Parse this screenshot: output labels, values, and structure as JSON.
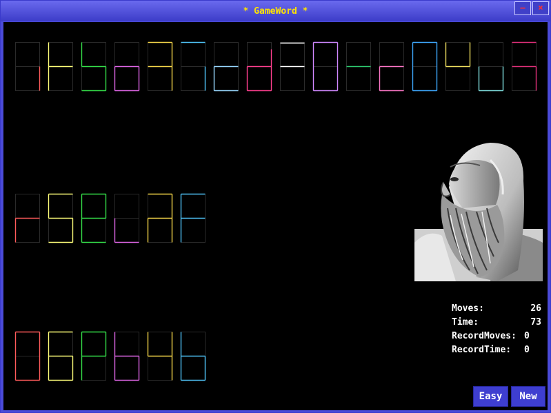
{
  "window": {
    "title": "* GameWord *",
    "minimize_glyph": "–",
    "close_glyph": "×"
  },
  "colors": {
    "background": "#000000",
    "title_text": "#ffe400",
    "titlebar": "#4a4ad8",
    "button": "#3e3ed0",
    "dim_segment": "#2a2a2a"
  },
  "palette": [
    "#ff5b5b",
    "#ffff7a",
    "#35e04a",
    "#e066e6",
    "#f5d64a",
    "#4fc3f7",
    "#9ad8ff",
    "#ff3f8f",
    "#ffffff",
    "#d088ff",
    "#2ecc71",
    "#ff77c8",
    "#3fa9ff",
    "#f0e060",
    "#80e0e0",
    "#e0307a"
  ],
  "rows": [
    {
      "name": "source-letters",
      "cells": [
        {
          "color": "#ff5b5b",
          "segments": [
            "br"
          ]
        },
        {
          "color": "#ffff7a",
          "segments": [
            "tl",
            "top_mid",
            "bl"
          ]
        },
        {
          "color": "#35e04a",
          "segments": [
            "tl",
            "mid",
            "br",
            "bottom"
          ]
        },
        {
          "color": "#e066e6",
          "segments": [
            "mid",
            "bl",
            "br",
            "bottom"
          ]
        },
        {
          "color": "#f5d64a",
          "segments": [
            "top",
            "mid",
            "tr",
            "br"
          ]
        },
        {
          "color": "#4fc3f7",
          "segments": [
            "top",
            "br",
            "mid_right"
          ]
        },
        {
          "color": "#9ad8ff",
          "segments": [
            "mid",
            "bl",
            "bottom"
          ]
        },
        {
          "color": "#ff3f8f",
          "segments": [
            "mid",
            "bl",
            "br",
            "bottom",
            "tr_low"
          ]
        },
        {
          "color": "#ffffff",
          "segments": [
            "top_thin",
            "mid"
          ]
        },
        {
          "color": "#d088ff",
          "segments": [
            "top",
            "tl",
            "tr",
            "bl",
            "br",
            "bottom"
          ]
        },
        {
          "color": "#2ecc71",
          "segments": [
            "mid"
          ]
        },
        {
          "color": "#ff77c8",
          "segments": [
            "mid",
            "bl",
            "bottom"
          ]
        },
        {
          "color": "#3fa9ff",
          "segments": [
            "top",
            "tl",
            "tr",
            "bl",
            "br",
            "bottom"
          ]
        },
        {
          "color": "#f0e060",
          "segments": [
            "tl",
            "mid",
            "tr"
          ]
        },
        {
          "color": "#80e0e0",
          "segments": [
            "bl",
            "br",
            "bottom"
          ]
        },
        {
          "color": "#e0307a",
          "segments": [
            "top",
            "mid",
            "br"
          ]
        }
      ]
    },
    {
      "name": "current-word",
      "cells": [
        {
          "color": "#ff5b5b",
          "segments": [
            "mid",
            "bl"
          ]
        },
        {
          "color": "#ffff7a",
          "segments": [
            "top",
            "tl",
            "mid",
            "br",
            "bottom"
          ]
        },
        {
          "color": "#35e04a",
          "segments": [
            "top",
            "tl",
            "tr",
            "mid",
            "bl",
            "bottom"
          ]
        },
        {
          "color": "#e066e6",
          "segments": [
            "bl",
            "bottom"
          ]
        },
        {
          "color": "#f5d64a",
          "segments": [
            "top",
            "tr",
            "mid",
            "bl",
            "br"
          ]
        },
        {
          "color": "#4fc3f7",
          "segments": [
            "top",
            "tl",
            "mid",
            "bl"
          ]
        }
      ]
    },
    {
      "name": "target-word",
      "cells": [
        {
          "color": "#ff5b5b",
          "segments": [
            "top",
            "tl",
            "tr",
            "bl",
            "br",
            "bottom"
          ]
        },
        {
          "color": "#ffff7a",
          "segments": [
            "top",
            "tl",
            "mid",
            "bl",
            "br",
            "bottom"
          ]
        },
        {
          "color": "#35e04a",
          "segments": [
            "top",
            "tl",
            "tr",
            "mid",
            "bl"
          ]
        },
        {
          "color": "#e066e6",
          "segments": [
            "tl",
            "mid",
            "bl",
            "bottom",
            "br"
          ]
        },
        {
          "color": "#f5d64a",
          "segments": [
            "tl",
            "tr",
            "mid",
            "br"
          ]
        },
        {
          "color": "#4fc3f7",
          "segments": [
            "tl",
            "mid",
            "bl",
            "br",
            "bottom"
          ]
        }
      ]
    }
  ],
  "stats": {
    "moves_label": "Moves:",
    "moves_value": "26",
    "time_label": "Time:",
    "time_value": "73",
    "record_moves_label": "RecordMoves:",
    "record_moves_value": "0",
    "record_time_label": "RecordTime:",
    "record_time_value": "0"
  },
  "buttons": {
    "easy_label": "Easy",
    "new_label": "New"
  },
  "portrait": {
    "icon": "bearded-scholar-portrait"
  }
}
